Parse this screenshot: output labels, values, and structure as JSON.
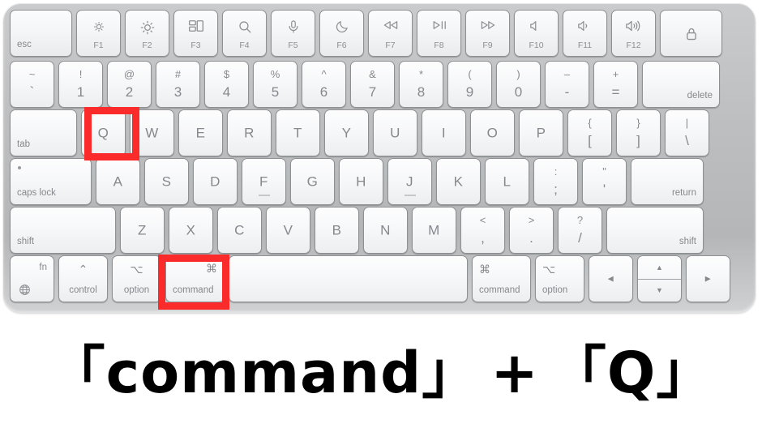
{
  "device": {
    "name": "apple-magic-keyboard",
    "body_color": "#bcbec0",
    "key_color": "#f7f8f9",
    "legend_color": "#85888c"
  },
  "highlight": {
    "color": "#fc2b2b",
    "keys": [
      "Q",
      "command"
    ]
  },
  "caption": {
    "left_bracket": "「",
    "right_bracket": "」",
    "first_key": "command",
    "plus": "+",
    "second_key": "Q",
    "full_text": "「command」 + 「Q」"
  },
  "rows": {
    "function": [
      {
        "id": "esc",
        "label": "esc",
        "pos": "bl",
        "icon": null,
        "fn": null,
        "width": "w-esc"
      },
      {
        "id": "f1",
        "label": null,
        "pos": null,
        "icon": "brightness-down-icon",
        "fn": "F1"
      },
      {
        "id": "f2",
        "label": null,
        "pos": null,
        "icon": "brightness-up-icon",
        "fn": "F2"
      },
      {
        "id": "f3",
        "label": null,
        "pos": null,
        "icon": "mission-control-icon",
        "fn": "F3"
      },
      {
        "id": "f4",
        "label": null,
        "pos": null,
        "icon": "spotlight-search-icon",
        "fn": "F4"
      },
      {
        "id": "f5",
        "label": null,
        "pos": null,
        "icon": "dictation-mic-icon",
        "fn": "F5"
      },
      {
        "id": "f6",
        "label": null,
        "pos": null,
        "icon": "do-not-disturb-moon-icon",
        "fn": "F6"
      },
      {
        "id": "f7",
        "label": null,
        "pos": null,
        "icon": "rewind-icon",
        "fn": "F7"
      },
      {
        "id": "f8",
        "label": null,
        "pos": null,
        "icon": "play-pause-icon",
        "fn": "F8"
      },
      {
        "id": "f9",
        "label": null,
        "pos": null,
        "icon": "fast-forward-icon",
        "fn": "F9"
      },
      {
        "id": "f10",
        "label": null,
        "pos": null,
        "icon": "volume-mute-icon",
        "fn": "F10"
      },
      {
        "id": "f11",
        "label": null,
        "pos": null,
        "icon": "volume-down-icon",
        "fn": "F11"
      },
      {
        "id": "f12",
        "label": null,
        "pos": null,
        "icon": "volume-up-icon",
        "fn": "F12"
      },
      {
        "id": "touchid",
        "label": null,
        "pos": null,
        "icon": "lock-touchid-icon",
        "fn": null,
        "width": "w-lock"
      }
    ],
    "number": [
      {
        "id": "grave",
        "up": "~",
        "dn": "`"
      },
      {
        "id": "1",
        "up": "!",
        "dn": "1"
      },
      {
        "id": "2",
        "up": "@",
        "dn": "2"
      },
      {
        "id": "3",
        "up": "#",
        "dn": "3"
      },
      {
        "id": "4",
        "up": "$",
        "dn": "4"
      },
      {
        "id": "5",
        "up": "%",
        "dn": "5"
      },
      {
        "id": "6",
        "up": "^",
        "dn": "6"
      },
      {
        "id": "7",
        "up": "&",
        "dn": "7"
      },
      {
        "id": "8",
        "up": "*",
        "dn": "8"
      },
      {
        "id": "9",
        "up": "(",
        "dn": "9"
      },
      {
        "id": "0",
        "up": ")",
        "dn": "0"
      },
      {
        "id": "minus",
        "up": "–",
        "dn": "-"
      },
      {
        "id": "equal",
        "up": "+",
        "dn": "="
      },
      {
        "id": "delete",
        "label": "delete",
        "width": "w-del"
      }
    ],
    "qwerty": [
      {
        "id": "tab",
        "label": "tab",
        "width": "w-tab"
      },
      {
        "id": "q",
        "glyph": "Q"
      },
      {
        "id": "w",
        "glyph": "W"
      },
      {
        "id": "e",
        "glyph": "E"
      },
      {
        "id": "r",
        "glyph": "R"
      },
      {
        "id": "t",
        "glyph": "T"
      },
      {
        "id": "y",
        "glyph": "Y"
      },
      {
        "id": "u",
        "glyph": "U"
      },
      {
        "id": "i",
        "glyph": "I"
      },
      {
        "id": "o",
        "glyph": "O"
      },
      {
        "id": "p",
        "glyph": "P"
      },
      {
        "id": "lbracket",
        "up": "{",
        "dn": "["
      },
      {
        "id": "rbracket",
        "up": "}",
        "dn": "]"
      },
      {
        "id": "backslash",
        "up": "|",
        "dn": "\\"
      }
    ],
    "home": [
      {
        "id": "capslock",
        "label": "caps lock",
        "width": "w-caps"
      },
      {
        "id": "a",
        "glyph": "A"
      },
      {
        "id": "s",
        "glyph": "S"
      },
      {
        "id": "d",
        "glyph": "D"
      },
      {
        "id": "f",
        "glyph": "F",
        "home_bar": true
      },
      {
        "id": "g",
        "glyph": "G"
      },
      {
        "id": "h",
        "glyph": "H"
      },
      {
        "id": "j",
        "glyph": "J",
        "home_bar": true
      },
      {
        "id": "k",
        "glyph": "K"
      },
      {
        "id": "l",
        "glyph": "L"
      },
      {
        "id": "semicolon",
        "up": ":",
        "dn": ";"
      },
      {
        "id": "quote",
        "up": "\"",
        "dn": "'"
      },
      {
        "id": "return",
        "label": "return",
        "width": "w-return"
      }
    ],
    "bottom_letters": [
      {
        "id": "shift-left",
        "label": "shift",
        "width": "w-shiftl"
      },
      {
        "id": "z",
        "glyph": "Z"
      },
      {
        "id": "x",
        "glyph": "X"
      },
      {
        "id": "c",
        "glyph": "C"
      },
      {
        "id": "v",
        "glyph": "V"
      },
      {
        "id": "b",
        "glyph": "B"
      },
      {
        "id": "n",
        "glyph": "N"
      },
      {
        "id": "m",
        "glyph": "M"
      },
      {
        "id": "comma",
        "up": "<",
        "dn": ","
      },
      {
        "id": "period",
        "up": ">",
        "dn": "."
      },
      {
        "id": "slash",
        "up": "?",
        "dn": "/"
      },
      {
        "id": "shift-right",
        "label": "shift",
        "width": "w-shiftr"
      }
    ],
    "modifier": [
      {
        "id": "globe-fn",
        "label": "fn",
        "icon": "globe-icon",
        "width": "w-globe"
      },
      {
        "id": "control",
        "label": "control",
        "symbol": "⌃",
        "width": "w-ctrl"
      },
      {
        "id": "option-left",
        "label": "option",
        "symbol": "⌥",
        "width": "w-opt"
      },
      {
        "id": "command-left",
        "label": "command",
        "symbol": "⌘",
        "width": "w-cmdl"
      },
      {
        "id": "space",
        "label": "",
        "symbol": null,
        "width": "w-space"
      },
      {
        "id": "command-right",
        "label": "command",
        "symbol": "⌘",
        "width": "w-cmdr"
      },
      {
        "id": "option-right",
        "label": "option",
        "symbol": "⌥",
        "width": "w-optr"
      },
      {
        "id": "arrow-left",
        "label": "◀",
        "width": "w-arrow"
      },
      {
        "id": "arrow-updown",
        "up_label": "▲",
        "down_label": "▼",
        "width": "w-arrow"
      },
      {
        "id": "arrow-right",
        "label": "▶",
        "width": "w-arrow"
      }
    ]
  }
}
